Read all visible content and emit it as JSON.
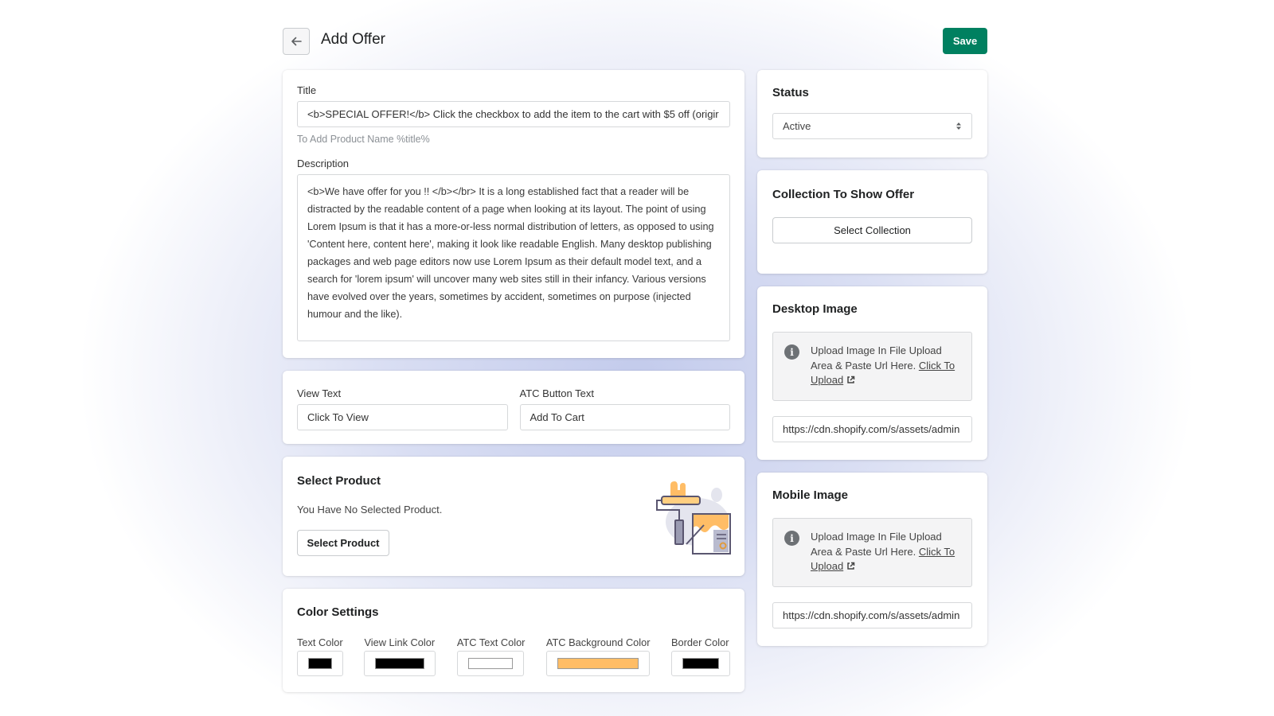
{
  "header": {
    "title": "Add Offer",
    "back_icon": "arrow-left-icon",
    "save_label": "Save"
  },
  "offer": {
    "title_label": "Title",
    "title_value": "<b>SPECIAL OFFER!</b> Click the checkbox to add the item to the cart with $5 off (origir",
    "title_help": "To Add Product Name %title%",
    "description_label": "Description",
    "description_value": "<b>We have offer for you !! </b></br> It is a long established fact that a reader will be distracted by the readable content of a page when looking at its layout. The point of using Lorem Ipsum is that it has a more-or-less normal distribution of letters, as opposed to using 'Content here, content here', making it look like readable English. Many desktop publishing packages and web page editors now use Lorem Ipsum as their default model text, and a search for 'lorem ipsum' will uncover many web sites still in their infancy. Various versions have evolved over the years, sometimes by accident, sometimes on purpose (injected humour and the like)."
  },
  "texts": {
    "view_text_label": "View Text",
    "view_text_value": "Click To View",
    "atc_label": "ATC Button Text",
    "atc_value": "Add To Cart"
  },
  "product": {
    "title": "Select Product",
    "empty_message": "You Have No Selected Product.",
    "button_label": "Select Product",
    "illustration": "paint-roller-illustration"
  },
  "colors": {
    "title": "Color Settings",
    "items": [
      {
        "label": "Text Color",
        "value": "#000000"
      },
      {
        "label": "View Link Color",
        "value": "#000000"
      },
      {
        "label": "ATC Text Color",
        "value": "#ffffff"
      },
      {
        "label": "ATC Background Color",
        "value": "#ffbd66"
      },
      {
        "label": "Border Color",
        "value": "#000000"
      }
    ]
  },
  "status": {
    "title": "Status",
    "selected": "Active"
  },
  "collection": {
    "title": "Collection To Show Offer",
    "button_label": "Select Collection"
  },
  "desktop_image": {
    "title": "Desktop Image",
    "notice_text": "Upload Image In File Upload Area & Paste Url Here.",
    "link_text": "Click To Upload",
    "url_value": "https://cdn.shopify.com/s/assets/admin"
  },
  "mobile_image": {
    "title": "Mobile Image",
    "notice_text": "Upload Image In File Upload Area & Paste Url Here.",
    "link_text": "Click To Upload",
    "url_value": "https://cdn.shopify.com/s/assets/admin"
  },
  "theme": {
    "primary": "#008060"
  }
}
